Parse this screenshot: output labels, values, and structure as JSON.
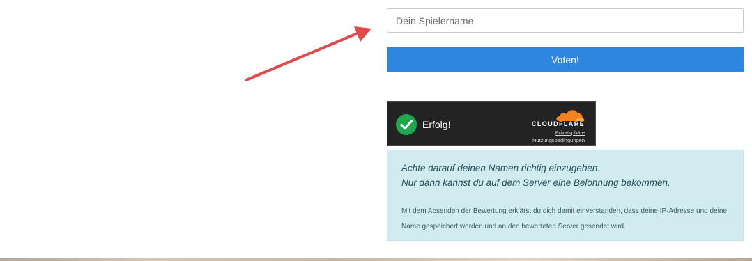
{
  "form": {
    "name_placeholder": "Dein Spielername",
    "name_value": "",
    "vote_label": "Voten!"
  },
  "captcha": {
    "status": "Erfolg!",
    "brand": "CLOUDFLARE",
    "privacy_link": "Privatsphäre",
    "terms_link": "Nutzungsbedingungen",
    "check_icon": "checkmark-circle-icon",
    "logo_icon": "cloudflare-cloud-icon"
  },
  "notice": {
    "line1": "Achte darauf deinen Namen richtig einzugeben.",
    "line2": "Nur dann kannst du auf dem Server eine Belohnung bekommen.",
    "disclaimer": "Mit dem Absenden der Bewertung erklärst du dich damit einverstanden, dass deine IP-Adresse und deine Name gespeichert werden und an den bewerteten Server gesendet wird."
  },
  "colors": {
    "vote_button": "#2e86de",
    "captcha_bg": "#232323",
    "success": "#1fa94f",
    "cloudflare_orange": "#f48120",
    "notice_bg": "#d1ecf1",
    "arrow": "#e04a4a"
  },
  "icons": {
    "annotation_arrow": "red-arrow-icon"
  }
}
